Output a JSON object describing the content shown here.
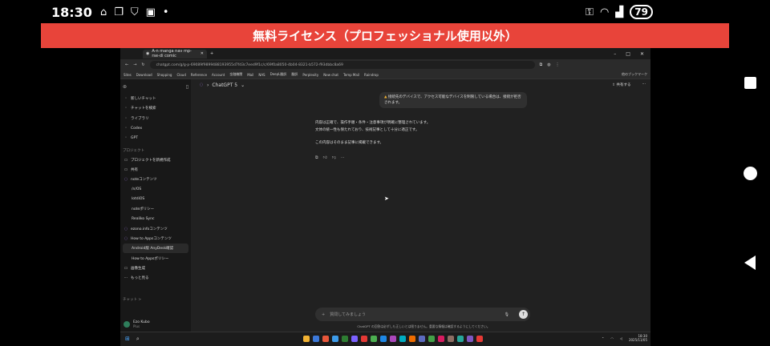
{
  "statusbar": {
    "time": "18:30",
    "battery": "79",
    "left_icons": [
      "home-alert-icon",
      "copy-icon",
      "shield-icon",
      "app-icon",
      "dot-icon"
    ],
    "right_icons": [
      "key-icon",
      "wifi-icon",
      "signal-icon"
    ]
  },
  "banner": {
    "text": "無料ライセンス（プロフェッショナル使用以外）",
    "color": "#e8443a"
  },
  "browser": {
    "tab_title": "A-n manga nav mp-rse-di comic",
    "url": "chatgpt.com/g/g-p-69089f9899488193955d7fd3c7eed9f1c/c/69f0a8050-4b04-8321-b572-f93dbbc8a69",
    "bookmarks": [
      "Sites",
      "Download",
      "Shopping",
      "Cloud",
      "Reference",
      "Account",
      "金融機関",
      "Mail",
      "NAS",
      "DeepL翻訳",
      "翻訳",
      "Perplexity",
      "New chat",
      "Temp Mail",
      "Raindrop"
    ],
    "bookmarks_right": "他のブックマーク"
  },
  "sidebar": {
    "items": [
      {
        "label": "新しいチャット",
        "icon": "edit-icon"
      },
      {
        "label": "チャットを検索",
        "icon": "search-icon"
      },
      {
        "label": "ライブラリ",
        "icon": "library-icon"
      },
      {
        "label": "Codex",
        "icon": "codex-icon"
      },
      {
        "label": "GPT",
        "icon": "grid-icon"
      }
    ],
    "projects_heading": "プロジェクト",
    "projects": [
      {
        "label": "プロジェクトを新規作成",
        "icon": "folder-plus-icon",
        "sub": false
      },
      {
        "label": "共有",
        "icon": "folder-icon",
        "sub": false
      },
      {
        "label": "noteコンテンツ",
        "icon": "project-icon",
        "sub": false
      },
      {
        "label": "/n/OS",
        "sub": true
      },
      {
        "label": "lotdiOS",
        "sub": true
      },
      {
        "label": "noteポリシー",
        "sub": true
      },
      {
        "label": "Realiko Sync",
        "sub": true
      },
      {
        "label": "ezono.infoコンテンツ",
        "icon": "project-icon",
        "sub": false
      },
      {
        "label": "How to Appsコンテンツ",
        "icon": "project-icon",
        "sub": false
      },
      {
        "label": "Android版 AnyDesk確認",
        "sub": true,
        "active": true
      },
      {
        "label": "How to Appsポリシー",
        "sub": true
      },
      {
        "label": "画像生成",
        "icon": "image-icon",
        "sub": false
      },
      {
        "label": "もっと見る",
        "icon": "more-icon",
        "sub": false
      }
    ],
    "chats_heading": "チャット >",
    "user_name": "Ezo Kubo",
    "user_plan": "Plus"
  },
  "main": {
    "model": "ChatGPT 5",
    "share": "共有する",
    "warning": "接続先のデバイスで、アクセス可能なデバイスを制限している場合は、接続が拒否されます。",
    "message": [
      "内容は正確で、操作手順・条件・注意事項が明確に整理されています。",
      "文体の統一性も保たれており、技術記事として十分に適正です。",
      "この内容はそのまま記事に掲載できます。"
    ],
    "input_placeholder": "質問してみましょう",
    "disclaimer": "ChatGPT の回答は必ずしも正しいとは限りません。重要な情報は確認するようにしてください。"
  },
  "taskbar": {
    "time": "18:30",
    "date": "2025/11/05",
    "app_colors": [
      "#f2b233",
      "#3c78d8",
      "#e8573a",
      "#3d9be9",
      "#2e7d32",
      "#7b61ff",
      "#e53935",
      "#4caf50",
      "#1e88e5",
      "#ab47bc",
      "#00acc1",
      "#ef6c00",
      "#5c6bc0",
      "#43a047",
      "#d81b60",
      "#8d6e63",
      "#26a69a",
      "#7e57c2",
      "#e53935"
    ]
  }
}
